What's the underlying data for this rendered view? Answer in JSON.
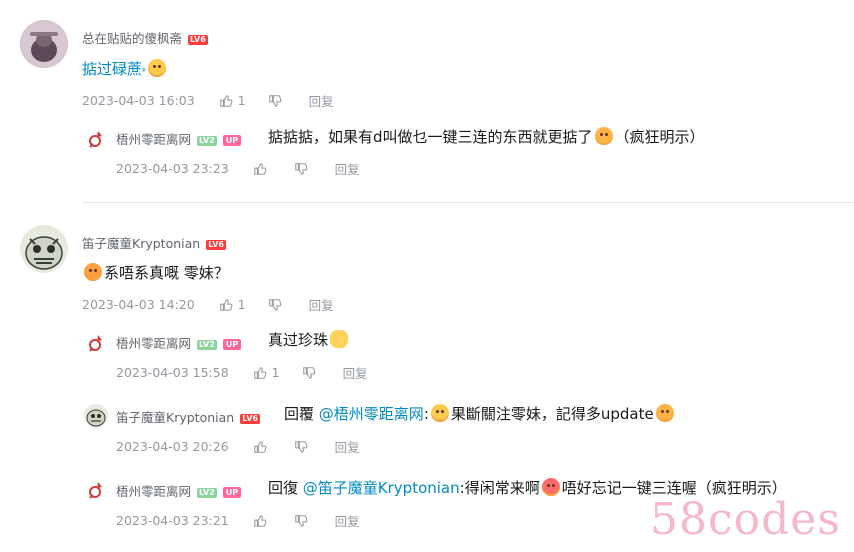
{
  "comments": [
    {
      "user": "总在贴贴的傻枫斋",
      "level": "LV6",
      "content": "掂过碌蔗",
      "content_suffix": "ᵠ",
      "time": "2023-04-03 16:03",
      "likes": "1",
      "reply_label": "回复",
      "replies": [
        {
          "user": "梧州零距离网",
          "level": "LV2",
          "badge": "UP",
          "content_a": "掂掂掂，如果有d叫做乜一键三连的东西就更掂了",
          "content_b": "（疯狂明示）",
          "time": "2023-04-03 23:23",
          "likes": "",
          "reply_label": "回复"
        }
      ]
    },
    {
      "user": "笛子魔童Kryptonian",
      "level": "LV6",
      "content": "系唔系真嘅 零妹？",
      "time": "2023-04-03 14:20",
      "likes": "1",
      "reply_label": "回复",
      "replies": [
        {
          "user": "梧州零距离网",
          "level": "LV2",
          "badge": "UP",
          "content_a": "真过珍珠",
          "time": "2023-04-03 15:58",
          "likes": "1",
          "reply_label": "回复"
        },
        {
          "user": "笛子魔童Kryptonian",
          "level": "LV6",
          "reply_prefix": "回覆",
          "mention": "@梧州零距离网",
          "content_a": ":",
          "content_b": "果斷關注零妹，記得多update",
          "time": "2023-04-03 20:26",
          "likes": "",
          "reply_label": "回复"
        },
        {
          "user": "梧州零距离网",
          "level": "LV2",
          "badge": "UP",
          "reply_prefix": "回復",
          "mention": "@笛子魔童Kryptonian",
          "content_a": ":得闲常来啊",
          "content_b": "唔好忘记一键三连喔（疯狂明示）",
          "time": "2023-04-03 23:21",
          "likes": "",
          "reply_label": "回复"
        }
      ]
    }
  ],
  "watermark": "58codes",
  "colors": {
    "link": "#008ac5",
    "up_badge": "#ff6699",
    "lv6": "#ff3b3b",
    "lv2": "#8bd29b",
    "meta": "#9499a0"
  }
}
